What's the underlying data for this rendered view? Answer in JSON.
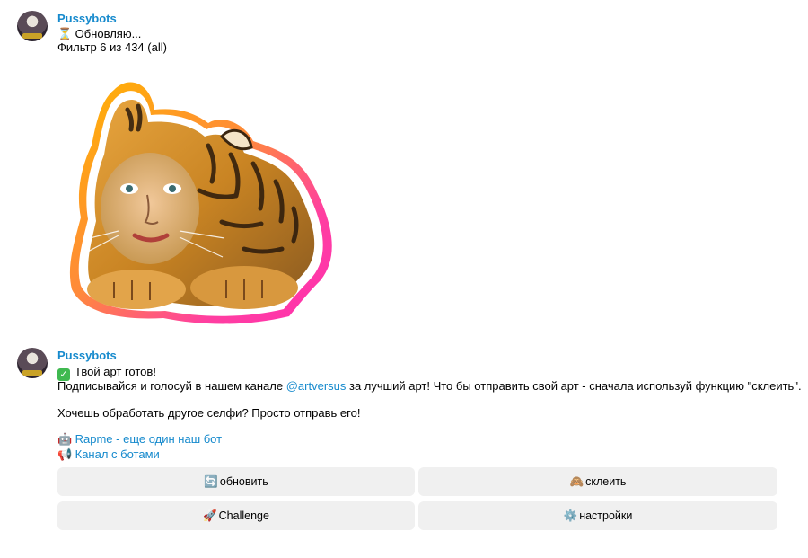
{
  "messages": [
    {
      "sender": "Pussybots",
      "status_icon": "hourglass-icon",
      "status_text": "Обновляю...",
      "filter_text": "Фильтр 6 из 434 (all)"
    },
    {
      "sender": "Pussybots",
      "ready_text": "Твой арт готов!",
      "promo_before": "Подписывайся и голосуй в нашем канале ",
      "promo_link": "@artversus",
      "promo_after": " за лучший арт! Что бы отправить свой арт - сначала используй функцию \"склеить\".",
      "hint_text": "Хочешь обработать другое селфи? Просто отправь его!",
      "links": [
        {
          "icon": "robot-icon",
          "label": "Rapme - еще один наш бот"
        },
        {
          "icon": "megaphone-icon",
          "label": "Канал с ботами"
        }
      ],
      "buttons": [
        {
          "icon": "refresh-icon",
          "label": "обновить"
        },
        {
          "icon": "monkey-icon",
          "label": "склеить"
        },
        {
          "icon": "rocket-icon",
          "label": "Challenge"
        },
        {
          "icon": "gear-icon",
          "label": "настройки"
        }
      ]
    }
  ],
  "colors": {
    "accent": "#168acd",
    "button_bg": "#f0f0f0",
    "check": "#3fb950"
  }
}
